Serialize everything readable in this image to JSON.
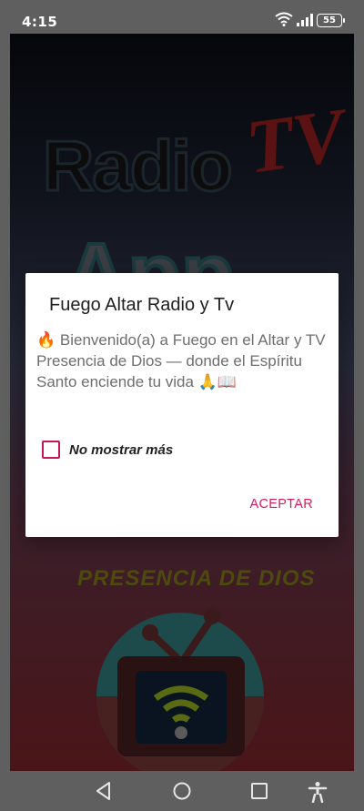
{
  "status_bar": {
    "time": "4:15",
    "battery": "55",
    "icons": [
      "wifi-icon",
      "signal-icon",
      "battery-icon"
    ]
  },
  "background": {
    "brand_radio": "Radio",
    "brand_tv": "TV",
    "brand_app": "App",
    "brand_presencia": "PRESENCIA DE DIOS"
  },
  "dialog": {
    "title": "Fuego Altar Radio y Tv",
    "message": "🔥 Bienvenido(a) a Fuego en el Altar y TV Presencia de Dios — donde el Espíritu Santo enciende tu vida 🙏📖",
    "checkbox_label": "No mostrar más",
    "checkbox_checked": false,
    "accept_label": "ACEPTAR",
    "accent_color": "#d81b60"
  },
  "nav_bar": {
    "icons": [
      "back-icon",
      "home-icon",
      "recents-icon",
      "accessibility-icon"
    ]
  }
}
